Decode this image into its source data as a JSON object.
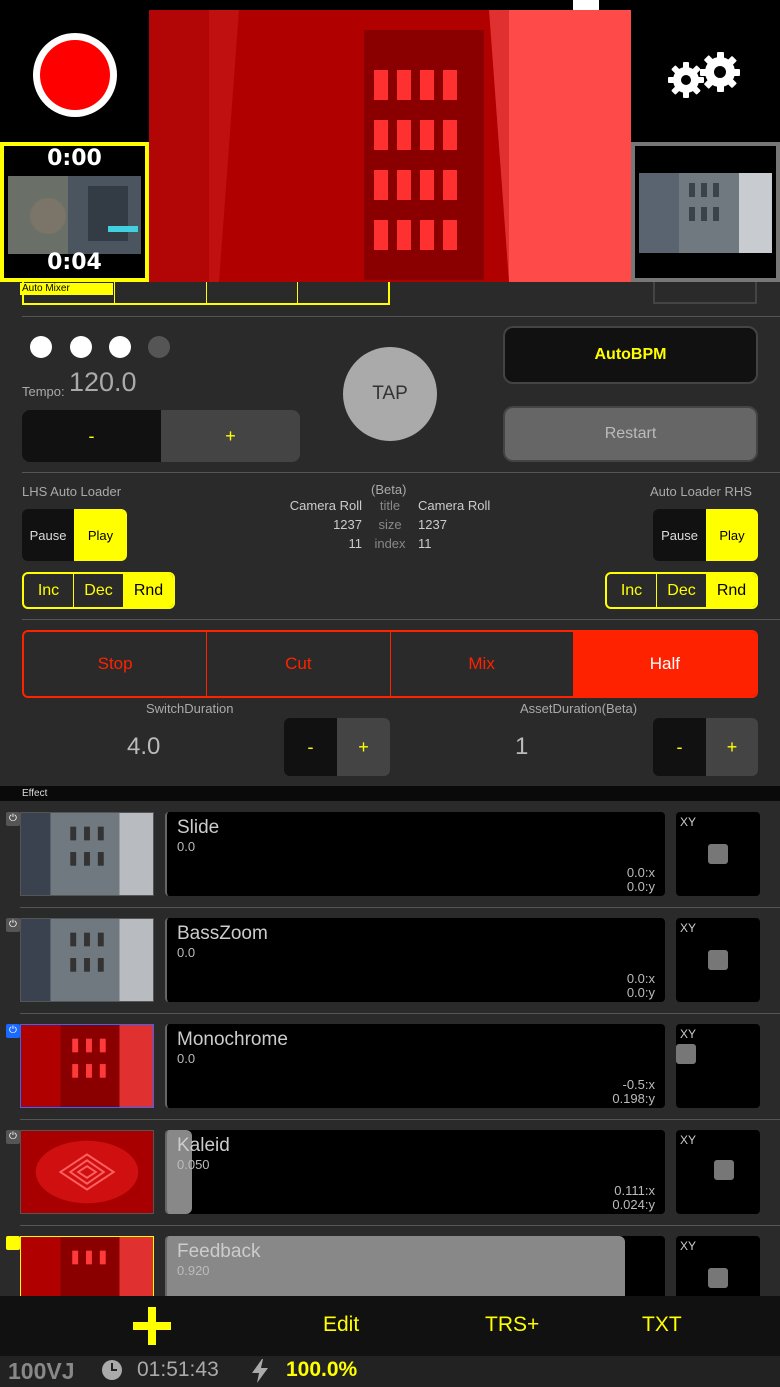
{
  "top": {
    "lhs_time_start": "0:00",
    "lhs_time_end": "0:04"
  },
  "mixer": {
    "label": "Auto Mixer"
  },
  "tempo": {
    "caption": "Tempo:",
    "value": "120.0",
    "minus": "-",
    "plus": "+",
    "tap": "TAP",
    "autobpm": "AutoBPM",
    "restart": "Restart"
  },
  "loaders": {
    "lhs_label": "LHS Auto Loader",
    "rhs_label": "Auto Loader RHS",
    "beta": "(Beta)",
    "keys": [
      "title",
      "size",
      "index"
    ],
    "lhs_values": [
      "Camera Roll",
      "1237",
      "11"
    ],
    "rhs_values": [
      "Camera Roll",
      "1237",
      "11"
    ],
    "pause": "Pause",
    "play": "Play",
    "inc": "Inc",
    "dec": "Dec",
    "rnd": "Rnd"
  },
  "switch": {
    "modes": [
      "Stop",
      "Cut",
      "Mix",
      "Half"
    ],
    "selected": "Half",
    "switch_label": "SwitchDuration",
    "switch_value": "4.0",
    "asset_label": "AssetDuration(Beta)",
    "asset_value": "1",
    "minus": "-",
    "plus": "+"
  },
  "effects": {
    "header": "Effect",
    "xy_label": "XY",
    "items": [
      {
        "name": "Slide",
        "value": "0.0",
        "x": "0.0:x",
        "y": "0.0:y",
        "level": 0.0,
        "active": false
      },
      {
        "name": "BassZoom",
        "value": "0.0",
        "x": "0.0:x",
        "y": "0.0:y",
        "level": 0.0,
        "active": false
      },
      {
        "name": "Monochrome",
        "value": "0.0",
        "x": "-0.5:x",
        "y": "0.198:y",
        "level": 0.0,
        "active": true
      },
      {
        "name": "Kaleid",
        "value": "0.050",
        "x": "0.111:x",
        "y": "0.024:y",
        "level": 0.05,
        "active": false
      },
      {
        "name": "Feedback",
        "value": "0.920",
        "x": "",
        "y": "",
        "level": 0.92,
        "active": true
      }
    ]
  },
  "toolbar": {
    "edit": "Edit",
    "trs": "TRS+",
    "txt": "TXT"
  },
  "status": {
    "brand": "100VJ",
    "time": "01:51:43",
    "battery": "100.0%"
  },
  "colors": {
    "accent": "#ffff00",
    "record": "#ff0000",
    "mode_active": "#ff2200"
  }
}
